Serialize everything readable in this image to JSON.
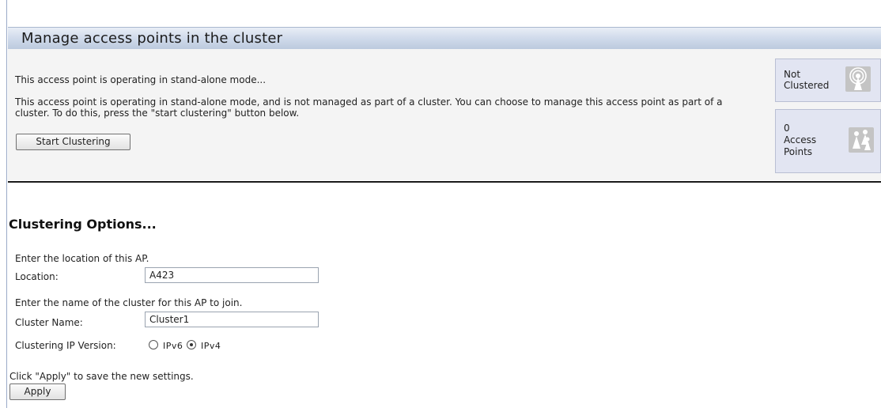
{
  "page": {
    "title": "Manage access points in the cluster"
  },
  "status": {
    "summary": "This access point is operating in stand-alone mode...",
    "description": "This access point is operating in stand-alone mode, and is not managed as part of a cluster. You can choose to manage this access point as part of a cluster. To do this, press the \"start clustering\" button below.",
    "start_button_label": "Start Clustering"
  },
  "side_panels": {
    "cluster_state": {
      "line1": "Not",
      "line2": "Clustered",
      "icon": "wireless-tower-icon"
    },
    "access_points": {
      "count": "0",
      "line1": "Access",
      "line2": "Points",
      "icon": "access-points-icon"
    }
  },
  "options": {
    "heading": "Clustering Options...",
    "location_hint": "Enter the location of this AP.",
    "location_label": "Location:",
    "location_value": "A423",
    "cluster_hint": "Enter the name of the cluster for this AP to join.",
    "cluster_label": "Cluster Name:",
    "cluster_value": "Cluster1",
    "ip_version_label": "Clustering IP Version:",
    "ip_options": [
      {
        "label": "IPv6",
        "selected": false
      },
      {
        "label": "IPv4",
        "selected": true
      }
    ],
    "apply_hint": "Click \"Apply\" to save the new settings.",
    "apply_label": "Apply"
  }
}
